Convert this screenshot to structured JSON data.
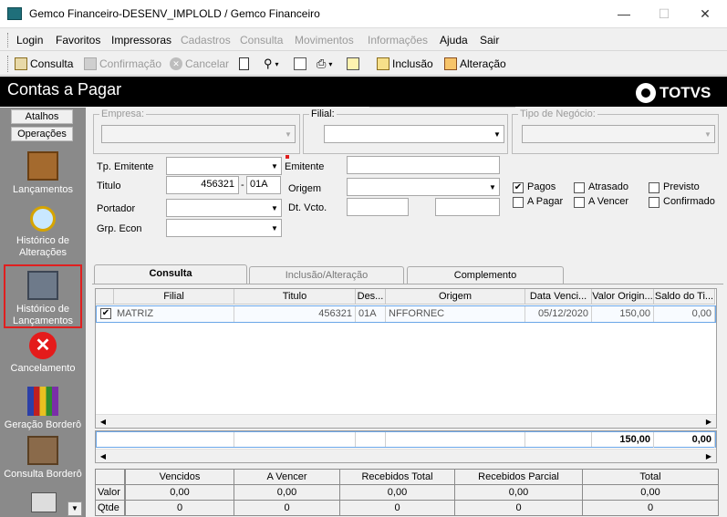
{
  "window": {
    "title": "Gemco Financeiro-DESENV_IMPLOLD / Gemco Financeiro",
    "minimize": "—",
    "maximize": "☐",
    "close": "✕"
  },
  "menu": [
    {
      "label": "Login",
      "enabled": true
    },
    {
      "label": "Favoritos",
      "enabled": true
    },
    {
      "label": "Impressoras",
      "enabled": true
    },
    {
      "label": "Cadastros",
      "enabled": false
    },
    {
      "label": "Consulta",
      "enabled": false
    },
    {
      "label": "Movimentos",
      "enabled": false
    },
    {
      "label": "Informações",
      "enabled": false
    },
    {
      "label": "Ajuda",
      "enabled": true
    },
    {
      "label": "Sair",
      "enabled": true
    }
  ],
  "toolbar": {
    "consulta": "Consulta",
    "confirmacao": "Confirmação",
    "cancelar": "Cancelar",
    "inclusao": "Inclusão",
    "alteracao": "Alteração"
  },
  "header": {
    "title": "Contas a Pagar",
    "logo": "TOTVS"
  },
  "sidebar": {
    "tab_atalhos": "Atalhos",
    "tab_operacoes": "Operações",
    "items": [
      {
        "label": "Lançamentos",
        "icon": "box-icon"
      },
      {
        "label": "Histórico de Alterações",
        "icon": "magnifier-icon"
      },
      {
        "label": "Histórico de Lançamentos",
        "icon": "printer-box-icon"
      },
      {
        "label": "Cancelamento",
        "icon": "cancel-icon"
      },
      {
        "label": "Geração Borderô",
        "icon": "books-icon"
      },
      {
        "label": "Consulta Borderô",
        "icon": "binder-icon"
      }
    ]
  },
  "filters": {
    "empresa": "Empresa:",
    "filial": "Filial:",
    "tipo_negocio": "Tipo de Negócio:",
    "tp_emitente": "Tp. Emitente",
    "emitente": "Emitente",
    "titulo": "Titulo",
    "titulo_value": "456321",
    "titulo_sep": "-",
    "titulo_suffix": "01A",
    "origem": "Origem",
    "portador": "Portador",
    "dt_vcto": "Dt. Vcto.",
    "grp_econ": "Grp. Econ"
  },
  "status": {
    "pagos": "Pagos",
    "a_pagar": "A Pagar",
    "atrasado": "Atrasado",
    "a_vencer": "A Vencer",
    "previsto": "Previsto",
    "confirmado": "Confirmado",
    "pagos_checked": "✔"
  },
  "tabs": {
    "consulta": "Consulta",
    "inclusao": "Inclusão/Alteração",
    "complemento": "Complemento"
  },
  "grid": {
    "headers": [
      "Filial",
      "Titulo",
      "Des...",
      "Origem",
      "Data Venci...",
      "Valor Origin...",
      "Saldo do Ti..."
    ],
    "row": {
      "check": "✔",
      "filial": "MATRIZ",
      "titulo": "456321",
      "des": "01A",
      "origem": "NFFORNEC",
      "data": "05/12/2020",
      "valor": "150,00",
      "saldo": "0,00"
    },
    "total_valor": "150,00",
    "total_saldo": "0,00"
  },
  "summary": {
    "headers": [
      "Vencidos",
      "A Vencer",
      "Recebidos Total",
      "Recebidos Parcial",
      "Total"
    ],
    "valor_label": "Valor",
    "qtde_label": "Qtde",
    "valor": [
      "0,00",
      "0,00",
      "0,00",
      "0,00",
      "0,00"
    ],
    "qtde": [
      "0",
      "0",
      "0",
      "0",
      "0"
    ]
  }
}
